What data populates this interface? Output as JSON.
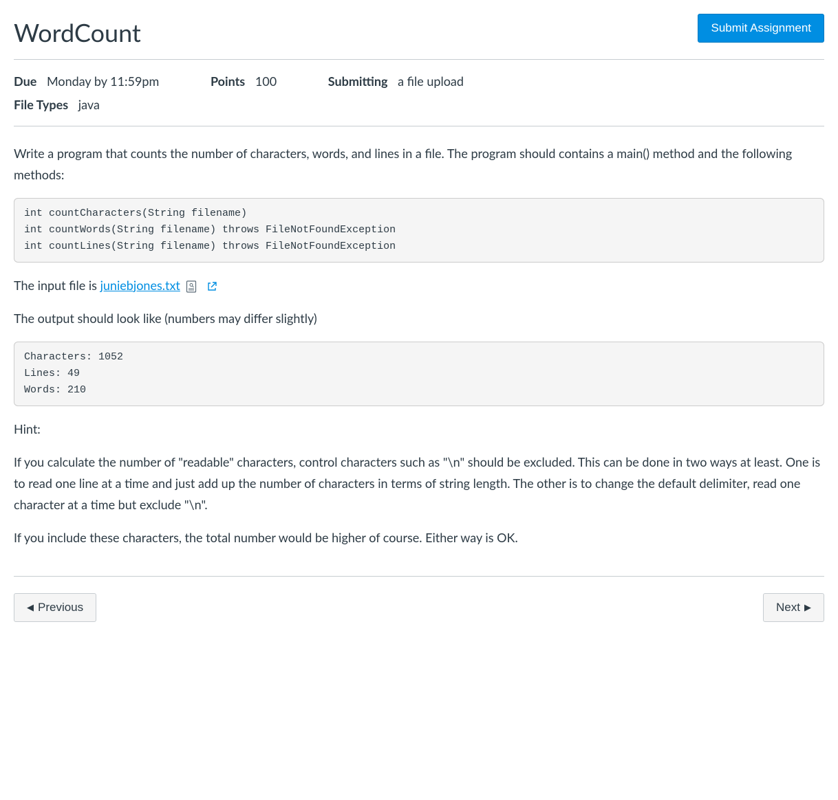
{
  "header": {
    "title": "WordCount",
    "submit_label": "Submit Assignment"
  },
  "meta": {
    "due_label": "Due",
    "due_value": "Monday by 11:59pm",
    "points_label": "Points",
    "points_value": "100",
    "submitting_label": "Submitting",
    "submitting_value": "a file upload",
    "filetypes_label": "File Types",
    "filetypes_value": "java"
  },
  "body": {
    "intro": "Write a program that counts the number of characters, words, and lines in a file. The program should contains a main() method and the following methods:",
    "code1": "int countCharacters(String filename)\nint countWords(String filename) throws FileNotFoundException\nint countLines(String filename) throws FileNotFoundException",
    "input_prefix": "The input file is ",
    "input_link": "juniebjones.txt",
    "output_intro": "The output should look like (numbers may differ slightly)",
    "code2": "Characters: 1052\nLines: 49\nWords: 210",
    "hint_label": "Hint:",
    "hint_p1": "If you calculate the number of \"readable\" characters, control characters such as \"\\n\" should be excluded. This can be done in two ways at least. One is to read one line at a time and just add up the number of characters in terms of string length. The other is to change the default delimiter, read one character at a time but exclude \"\\n\".",
    "hint_p2": "If you include these characters, the total number would be higher of course. Either way is OK."
  },
  "nav": {
    "prev_label": "Previous",
    "next_label": "Next"
  }
}
